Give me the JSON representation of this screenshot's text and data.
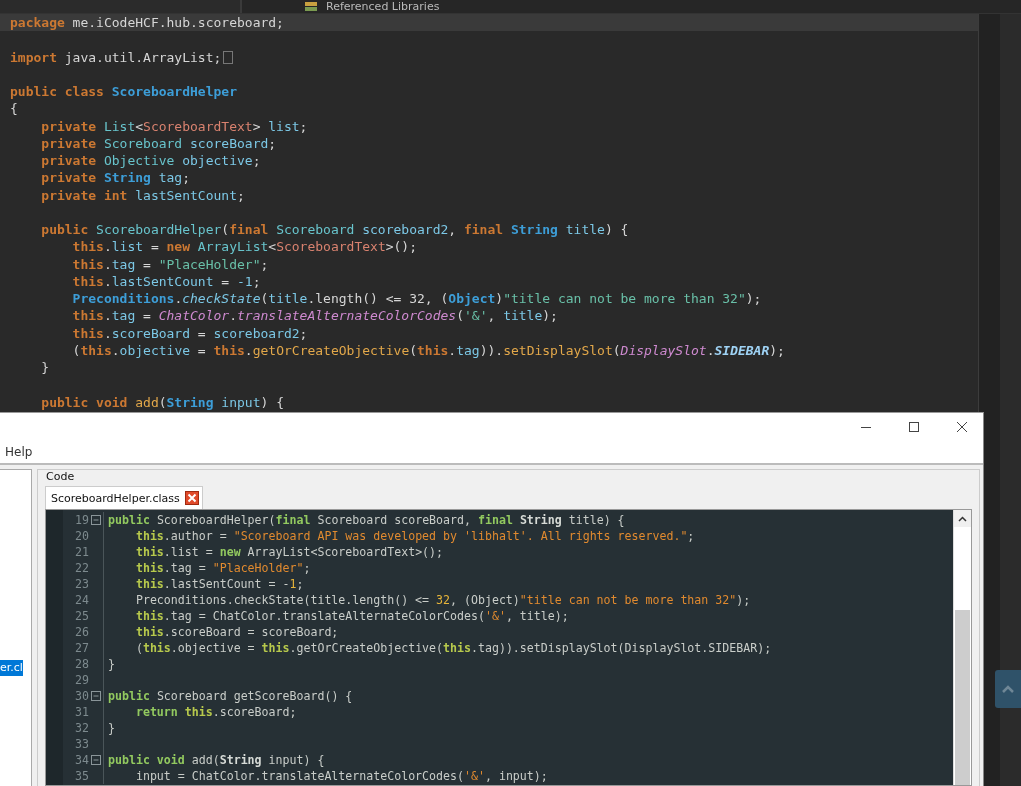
{
  "explorer": {
    "item": "Referenced Libraries"
  },
  "editor": {
    "lines": [
      {
        "current": true,
        "collapsed": false,
        "tokens": [
          {
            "kind": "kw",
            "text": "package"
          },
          {
            "kind": "plain",
            "text": " me.iCodeHCF.hub.scoreboard;"
          }
        ]
      },
      {
        "current": false,
        "collapsed": false
      },
      {
        "current": false,
        "collapsed": true,
        "tokens": [
          {
            "kind": "kw",
            "text": "import"
          },
          {
            "kind": "plain",
            "text": " java.util.ArrayList;"
          }
        ]
      },
      {
        "current": false,
        "collapsed": false
      },
      {
        "current": false,
        "collapsed": false,
        "tokens": [
          {
            "kind": "kw",
            "text": "public class "
          },
          {
            "kind": "cls",
            "text": "ScoreboardHelper"
          }
        ]
      },
      {
        "current": false,
        "collapsed": false,
        "tokens": [
          {
            "kind": "plain",
            "text": "{"
          }
        ]
      },
      {
        "current": false,
        "collapsed": false,
        "tokens": [
          {
            "kind": "kw",
            "text": "    private "
          },
          {
            "kind": "type",
            "text": "List"
          },
          {
            "kind": "plain",
            "text": "<"
          },
          {
            "kind": "gen",
            "text": "ScoreboardText"
          },
          {
            "kind": "plain",
            "text": "> "
          },
          {
            "kind": "field",
            "text": "list"
          },
          {
            "kind": "plain",
            "text": ";"
          }
        ]
      },
      {
        "current": false,
        "collapsed": false,
        "tokens": [
          {
            "kind": "kw",
            "text": "    private "
          },
          {
            "kind": "type",
            "text": "Scoreboard "
          },
          {
            "kind": "field",
            "text": "scoreBoard"
          },
          {
            "kind": "plain",
            "text": ";"
          }
        ]
      },
      {
        "current": false,
        "collapsed": false,
        "tokens": [
          {
            "kind": "kw",
            "text": "    private "
          },
          {
            "kind": "type",
            "text": "Objective "
          },
          {
            "kind": "field",
            "text": "objective"
          },
          {
            "kind": "plain",
            "text": ";"
          }
        ]
      },
      {
        "current": false,
        "collapsed": false,
        "tokens": [
          {
            "kind": "kw",
            "text": "    private "
          },
          {
            "kind": "cls",
            "text": "String "
          },
          {
            "kind": "field",
            "text": "tag"
          },
          {
            "kind": "plain",
            "text": ";"
          }
        ]
      },
      {
        "current": false,
        "collapsed": false,
        "tokens": [
          {
            "kind": "kw",
            "text": "    private int "
          },
          {
            "kind": "field",
            "text": "lastSentCount"
          },
          {
            "kind": "plain",
            "text": ";"
          }
        ]
      },
      {
        "current": false,
        "collapsed": false
      },
      {
        "current": false,
        "collapsed": false,
        "tokens": [
          {
            "kind": "kw",
            "text": "    public "
          },
          {
            "kind": "type",
            "text": "ScoreboardHelper"
          },
          {
            "kind": "plain",
            "text": "("
          },
          {
            "kind": "kw",
            "text": "final "
          },
          {
            "kind": "type",
            "text": "Scoreboard "
          },
          {
            "kind": "field",
            "text": "scoreboard2"
          },
          {
            "kind": "plain",
            "text": ", "
          },
          {
            "kind": "kw",
            "text": "final "
          },
          {
            "kind": "cls",
            "text": "String "
          },
          {
            "kind": "field",
            "text": "title"
          },
          {
            "kind": "plain",
            "text": ") {"
          }
        ]
      },
      {
        "current": false,
        "collapsed": false,
        "tokens": [
          {
            "kind": "kw",
            "text": "        this"
          },
          {
            "kind": "plain",
            "text": "."
          },
          {
            "kind": "field",
            "text": "list"
          },
          {
            "kind": "plain",
            "text": " = "
          },
          {
            "kind": "kw",
            "text": "new "
          },
          {
            "kind": "type",
            "text": "ArrayList"
          },
          {
            "kind": "plain",
            "text": "<"
          },
          {
            "kind": "gen",
            "text": "ScoreboardText"
          },
          {
            "kind": "plain",
            "text": ">();"
          }
        ]
      },
      {
        "current": false,
        "collapsed": false,
        "tokens": [
          {
            "kind": "kw",
            "text": "        this"
          },
          {
            "kind": "plain",
            "text": "."
          },
          {
            "kind": "field",
            "text": "tag"
          },
          {
            "kind": "plain",
            "text": " = "
          },
          {
            "kind": "str",
            "text": "\"PlaceHolder\""
          },
          {
            "kind": "plain",
            "text": ";"
          }
        ]
      },
      {
        "current": false,
        "collapsed": false,
        "tokens": [
          {
            "kind": "kw",
            "text": "        this"
          },
          {
            "kind": "plain",
            "text": "."
          },
          {
            "kind": "field",
            "text": "lastSentCount"
          },
          {
            "kind": "plain",
            "text": " = "
          },
          {
            "kind": "field",
            "text": "-1"
          },
          {
            "kind": "plain",
            "text": ";"
          }
        ]
      },
      {
        "current": false,
        "collapsed": false,
        "tokens": [
          {
            "kind": "cls",
            "text": "        Preconditions"
          },
          {
            "kind": "plain",
            "text": "."
          },
          {
            "kind": "method",
            "text": "checkState"
          },
          {
            "kind": "plain",
            "text": "("
          },
          {
            "kind": "field",
            "text": "title"
          },
          {
            "kind": "plain",
            "text": ".length() <= 32, ("
          },
          {
            "kind": "cls",
            "text": "Object"
          },
          {
            "kind": "plain",
            "text": ")"
          },
          {
            "kind": "str",
            "text": "\"title can not be more than 32\""
          },
          {
            "kind": "plain",
            "text": ");"
          }
        ]
      },
      {
        "current": false,
        "collapsed": false,
        "tokens": [
          {
            "kind": "kw",
            "text": "        this"
          },
          {
            "kind": "plain",
            "text": "."
          },
          {
            "kind": "field",
            "text": "tag"
          },
          {
            "kind": "plain",
            "text": " = "
          },
          {
            "kind": "static",
            "text": "ChatColor"
          },
          {
            "kind": "plain",
            "text": "."
          },
          {
            "kind": "static",
            "text": "translateAlternateColorCodes"
          },
          {
            "kind": "plain",
            "text": "("
          },
          {
            "kind": "str",
            "text": "'&'"
          },
          {
            "kind": "plain",
            "text": ", "
          },
          {
            "kind": "field",
            "text": "title"
          },
          {
            "kind": "plain",
            "text": ");"
          }
        ]
      },
      {
        "current": false,
        "collapsed": false,
        "tokens": [
          {
            "kind": "kw",
            "text": "        this"
          },
          {
            "kind": "plain",
            "text": "."
          },
          {
            "kind": "field",
            "text": "scoreBoard"
          },
          {
            "kind": "plain",
            "text": " = "
          },
          {
            "kind": "field",
            "text": "scoreboard2"
          },
          {
            "kind": "plain",
            "text": ";"
          }
        ]
      },
      {
        "current": false,
        "collapsed": false,
        "tokens": [
          {
            "kind": "plain",
            "text": "        ("
          },
          {
            "kind": "kw",
            "text": "this"
          },
          {
            "kind": "plain",
            "text": "."
          },
          {
            "kind": "field",
            "text": "objective"
          },
          {
            "kind": "plain",
            "text": " = "
          },
          {
            "kind": "kw",
            "text": "this"
          },
          {
            "kind": "plain",
            "text": "."
          },
          {
            "kind": "call",
            "text": "getOrCreateObjective"
          },
          {
            "kind": "plain",
            "text": "("
          },
          {
            "kind": "kw",
            "text": "this"
          },
          {
            "kind": "plain",
            "text": "."
          },
          {
            "kind": "field",
            "text": "tag"
          },
          {
            "kind": "plain",
            "text": "))."
          },
          {
            "kind": "call",
            "text": "setDisplaySlot"
          },
          {
            "kind": "plain",
            "text": "("
          },
          {
            "kind": "static",
            "text": "DisplaySlot"
          },
          {
            "kind": "plain",
            "text": "."
          },
          {
            "kind": "const",
            "text": "SIDEBAR"
          },
          {
            "kind": "plain",
            "text": ");"
          }
        ]
      },
      {
        "current": false,
        "collapsed": false,
        "tokens": [
          {
            "kind": "plain",
            "text": "    }"
          }
        ]
      },
      {
        "current": false,
        "collapsed": false
      },
      {
        "current": false,
        "collapsed": false,
        "tokens": [
          {
            "kind": "kw",
            "text": "    public void "
          },
          {
            "kind": "call",
            "text": "add"
          },
          {
            "kind": "plain",
            "text": "("
          },
          {
            "kind": "cls",
            "text": "String "
          },
          {
            "kind": "field",
            "text": "input"
          },
          {
            "kind": "plain",
            "text": ") {"
          }
        ]
      }
    ]
  },
  "decompiler": {
    "menu": [
      "Help"
    ],
    "tree": {
      "items": [
        {
          "label": "er.cl",
          "selected": true
        }
      ]
    },
    "group_label": "Code",
    "tabs": [
      {
        "label": "ScoreboardHelper.class",
        "selected": true
      }
    ],
    "lines": [
      {
        "number": "19",
        "fold": true,
        "tokens": [
          {
            "kind": "kw",
            "text": "public "
          },
          {
            "kind": "plain",
            "text": "ScoreboardHelper("
          },
          {
            "kind": "kw",
            "text": "final "
          },
          {
            "kind": "plain",
            "text": "Scoreboard scoreBoard, "
          },
          {
            "kind": "kw",
            "text": "final "
          },
          {
            "kind": "bold",
            "text": "String"
          },
          {
            "kind": "plain",
            "text": " title) {"
          }
        ]
      },
      {
        "number": "20",
        "fold": false,
        "tokens": [
          {
            "kind": "this",
            "text": "    this"
          },
          {
            "kind": "plain",
            "text": ".author = "
          },
          {
            "kind": "str",
            "text": "\"Scoreboard API was developed by 'libhalt'. All rights reserved.\""
          },
          {
            "kind": "plain",
            "text": ";"
          }
        ]
      },
      {
        "number": "21",
        "fold": false,
        "tokens": [
          {
            "kind": "this",
            "text": "    this"
          },
          {
            "kind": "plain",
            "text": ".list = "
          },
          {
            "kind": "kw",
            "text": "new "
          },
          {
            "kind": "plain",
            "text": "ArrayList<ScoreboardText>();"
          }
        ]
      },
      {
        "number": "22",
        "fold": false,
        "tokens": [
          {
            "kind": "this",
            "text": "    this"
          },
          {
            "kind": "plain",
            "text": ".tag = "
          },
          {
            "kind": "str",
            "text": "\"PlaceHolder\""
          },
          {
            "kind": "plain",
            "text": ";"
          }
        ]
      },
      {
        "number": "23",
        "fold": false,
        "tokens": [
          {
            "kind": "this",
            "text": "    this"
          },
          {
            "kind": "plain",
            "text": ".lastSentCount = -"
          },
          {
            "kind": "num",
            "text": "1"
          },
          {
            "kind": "plain",
            "text": ";"
          }
        ]
      },
      {
        "number": "24",
        "fold": false,
        "tokens": [
          {
            "kind": "plain",
            "text": "    Preconditions.checkState(title.length() <= "
          },
          {
            "kind": "num",
            "text": "32"
          },
          {
            "kind": "plain",
            "text": ", (Object)"
          },
          {
            "kind": "str",
            "text": "\"title can not be more than 32\""
          },
          {
            "kind": "plain",
            "text": ");"
          }
        ]
      },
      {
        "number": "25",
        "fold": false,
        "tokens": [
          {
            "kind": "this",
            "text": "    this"
          },
          {
            "kind": "plain",
            "text": ".tag = ChatColor.translateAlternateColorCodes("
          },
          {
            "kind": "str",
            "text": "'&'"
          },
          {
            "kind": "plain",
            "text": ", title);"
          }
        ]
      },
      {
        "number": "26",
        "fold": false,
        "tokens": [
          {
            "kind": "this",
            "text": "    this"
          },
          {
            "kind": "plain",
            "text": ".scoreBoard = scoreBoard;"
          }
        ]
      },
      {
        "number": "27",
        "fold": false,
        "tokens": [
          {
            "kind": "plain",
            "text": "    ("
          },
          {
            "kind": "this",
            "text": "this"
          },
          {
            "kind": "plain",
            "text": ".objective = "
          },
          {
            "kind": "this",
            "text": "this"
          },
          {
            "kind": "plain",
            "text": ".getOrCreateObjective("
          },
          {
            "kind": "this",
            "text": "this"
          },
          {
            "kind": "plain",
            "text": ".tag)).setDisplaySlot(DisplaySlot.SIDEBAR);"
          }
        ]
      },
      {
        "number": "28",
        "fold": false,
        "tokens": [
          {
            "kind": "plain",
            "text": "}"
          }
        ]
      },
      {
        "number": "29",
        "fold": false
      },
      {
        "number": "30",
        "fold": true,
        "tokens": [
          {
            "kind": "kw",
            "text": "public "
          },
          {
            "kind": "plain",
            "text": "Scoreboard getScoreBoard() {"
          }
        ]
      },
      {
        "number": "31",
        "fold": false,
        "tokens": [
          {
            "kind": "kw",
            "text": "    return "
          },
          {
            "kind": "this",
            "text": "this"
          },
          {
            "kind": "plain",
            "text": ".scoreBoard;"
          }
        ]
      },
      {
        "number": "32",
        "fold": false,
        "tokens": [
          {
            "kind": "plain",
            "text": "}"
          }
        ]
      },
      {
        "number": "33",
        "fold": false
      },
      {
        "number": "34",
        "fold": true,
        "tokens": [
          {
            "kind": "kw",
            "text": "public void "
          },
          {
            "kind": "plain",
            "text": "add("
          },
          {
            "kind": "bold",
            "text": "String"
          },
          {
            "kind": "plain",
            "text": " input) {"
          }
        ]
      },
      {
        "number": "35",
        "fold": false,
        "tokens": [
          {
            "kind": "plain",
            "text": "    input = ChatColor.translateAlternateColorCodes("
          },
          {
            "kind": "str",
            "text": "'&'"
          },
          {
            "kind": "plain",
            "text": ", input);"
          }
        ]
      }
    ]
  }
}
